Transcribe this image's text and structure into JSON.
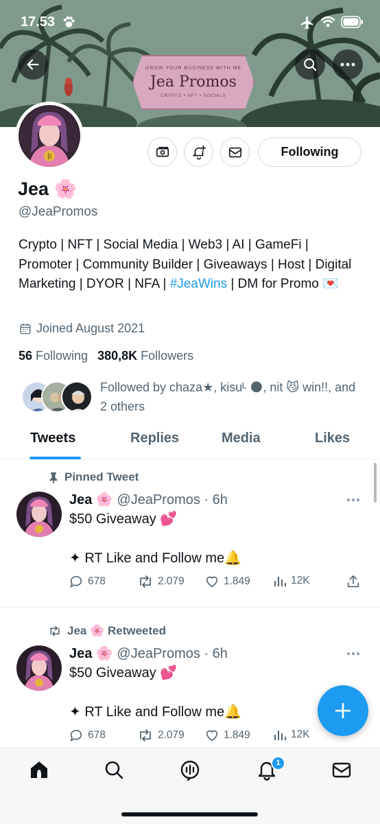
{
  "status_bar": {
    "time": "17.53"
  },
  "banner": {
    "promo_top": "GROW YOUR BUSINESS WITH ME",
    "promo_name": "Jea Promos",
    "promo_bottom": "CRYPTO • NFT • SOCIALS"
  },
  "profile": {
    "name": "Jea 🌸",
    "handle": "@JeaPromos",
    "bio_part1": "Crypto | NFT | Social Media | Web3 | AI | GameFi | Promoter | Community Builder | Giveaways | Host | Digital Marketing | DYOR | NFA | ",
    "bio_hashtag": "#JeaWins",
    "bio_part2": " | DM for Promo 💌",
    "joined": "Joined August 2021",
    "following_count": "56",
    "following_label": "Following",
    "followers_count": "380,8K",
    "followers_label": "Followers",
    "followed_by": "Followed by chaza★, kisuᴸ 🌑, nit 😼 win!!, and 2 others",
    "following_button": "Following"
  },
  "tabs": [
    "Tweets",
    "Replies",
    "Media",
    "Likes"
  ],
  "tweets": [
    {
      "context": "Pinned Tweet",
      "name": "Jea 🌸",
      "handle_time": "@JeaPromos · 6h",
      "line1": "$50 Giveaway 💕",
      "line2": "✦ RT Like and Follow me🔔",
      "replies": "678",
      "retweets": "2.079",
      "likes": "1.849",
      "views": "12K"
    },
    {
      "context": "Jea 🌸 Retweeted",
      "name": "Jea 🌸",
      "handle_time": "@JeaPromos · 6h",
      "line1": "$50 Giveaway 💕",
      "line2": "✦ RT Like and Follow me🔔",
      "replies": "678",
      "retweets": "2.079",
      "likes": "1.849",
      "views": "12K"
    }
  ],
  "notifications_badge": "1",
  "colors": {
    "accent": "#1d9bf0",
    "text": "#0f1419",
    "muted": "#536471",
    "border": "#cfd9de"
  },
  "icons": [
    "back-icon",
    "search-icon",
    "more-icon",
    "money-icon",
    "bell-plus-icon",
    "mail-icon",
    "calendar-icon",
    "pin-icon",
    "retweet-icon",
    "reply-icon",
    "like-icon",
    "views-icon",
    "share-icon",
    "compose-icon",
    "home-icon",
    "spaces-icon",
    "notifications-icon",
    "messages-icon"
  ]
}
